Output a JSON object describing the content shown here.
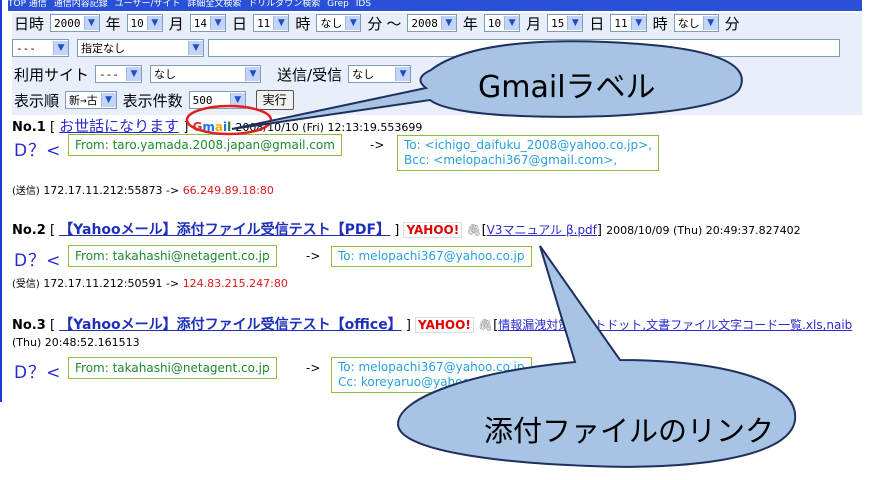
{
  "nav": {
    "links": [
      "TOP 通信",
      "通信内容記録",
      "ユーザー/サイト",
      "詳細全文検索",
      "ドリルダウン検索",
      "Grep",
      "IDS"
    ]
  },
  "search_form": {
    "datetime_label": "日時",
    "from": {
      "year": "2000",
      "year_unit": "年",
      "month": "10",
      "month_unit": "月",
      "day": "14",
      "day_unit": "日",
      "hour": "11",
      "hour_unit": "時",
      "minute": "なし",
      "minute_unit": "分"
    },
    "range_sep": "〜",
    "to": {
      "year": "2008",
      "year_unit": "年",
      "month": "10",
      "month_unit": "月",
      "day": "15",
      "day_unit": "日",
      "hour": "11",
      "hour_unit": "時",
      "minute": "なし",
      "minute_unit": "分"
    },
    "cond_select": "---",
    "cond_type_select": "指定なし",
    "cond_text_value": "",
    "site_label": "利用サイト",
    "site_select": "---",
    "site_detail_select": "なし",
    "direction_label": "送信/受信",
    "direction_select": "なし",
    "order_label": "表示順",
    "order_select": "新→古",
    "count_label": "表示件数",
    "count_select": "500",
    "run_button": "実行"
  },
  "entries": [
    {
      "no": "No.1",
      "bracket_open": "[",
      "subject": "お世話になります",
      "bracket_close": "]",
      "service": "Gmail",
      "datetime": "2008/10/10 (Fri) 12:13:19.553699",
      "icon": "D？<",
      "from": "From: taro.yamada.2008.japan@gmail.com",
      "arrow": "->",
      "to_lines": [
        "To: <ichigo_daifuku_2008@yahoo.co.jp>,",
        "Bcc: <melopachi367@gmail.com>,"
      ],
      "direction": "(送信)",
      "src_ip": "172.17.11.212:55873",
      "ip_arrow": "->",
      "dst_ip": "66.249.89.18:80"
    },
    {
      "no": "No.2",
      "bracket_open": "[",
      "subject": "【Yahooメール】添付ファイル受信テスト【PDF】",
      "bracket_close": "]",
      "service": "YAHOO!",
      "attachment_open": "[",
      "attachment": "V3マニュアル β.pdf",
      "attachment_close": "]",
      "datetime": "2008/10/09 (Thu) 20:49:37.827402",
      "icon": "D？<",
      "from": "From: takahashi@netagent.co.jp",
      "arrow": "->",
      "to_lines": [
        "To: melopachi367@yahoo.co.jp"
      ],
      "direction": "(受信)",
      "src_ip": "172.17.11.212:50591",
      "ip_arrow": "->",
      "dst_ip": "124.83.215.247:80"
    },
    {
      "no": "No.3",
      "bracket_open": "[",
      "subject": "【Yahooメール】添付ファイル受信テスト【office】",
      "bracket_close": "]",
      "service": "YAHOO!",
      "attachment_open": "[",
      "attachment": "情報漏洩対策ソフトドット,文書ファイル文字コード一覧.xls,naib",
      "datetime": "(Thu) 20:48:52.161513",
      "icon": "D？<",
      "from": "From: takahashi@netagent.co.jp",
      "arrow": "->",
      "to_lines": [
        "To: melopachi367@yahoo.co.jp",
        "Cc: koreyaruo@yahoo.co.jp"
      ]
    }
  ],
  "callouts": {
    "gmail_label": "Gmailラベル",
    "attachment_link": "添付ファイルのリンク"
  },
  "colors": {
    "callout_fill": "#a8c4e4",
    "callout_stroke": "#1f2f5e",
    "highlight_ellipse": "#e02020",
    "form_bg": "#e8eefa",
    "link": "#2a2ad0",
    "dst_ip": "#e01818"
  }
}
